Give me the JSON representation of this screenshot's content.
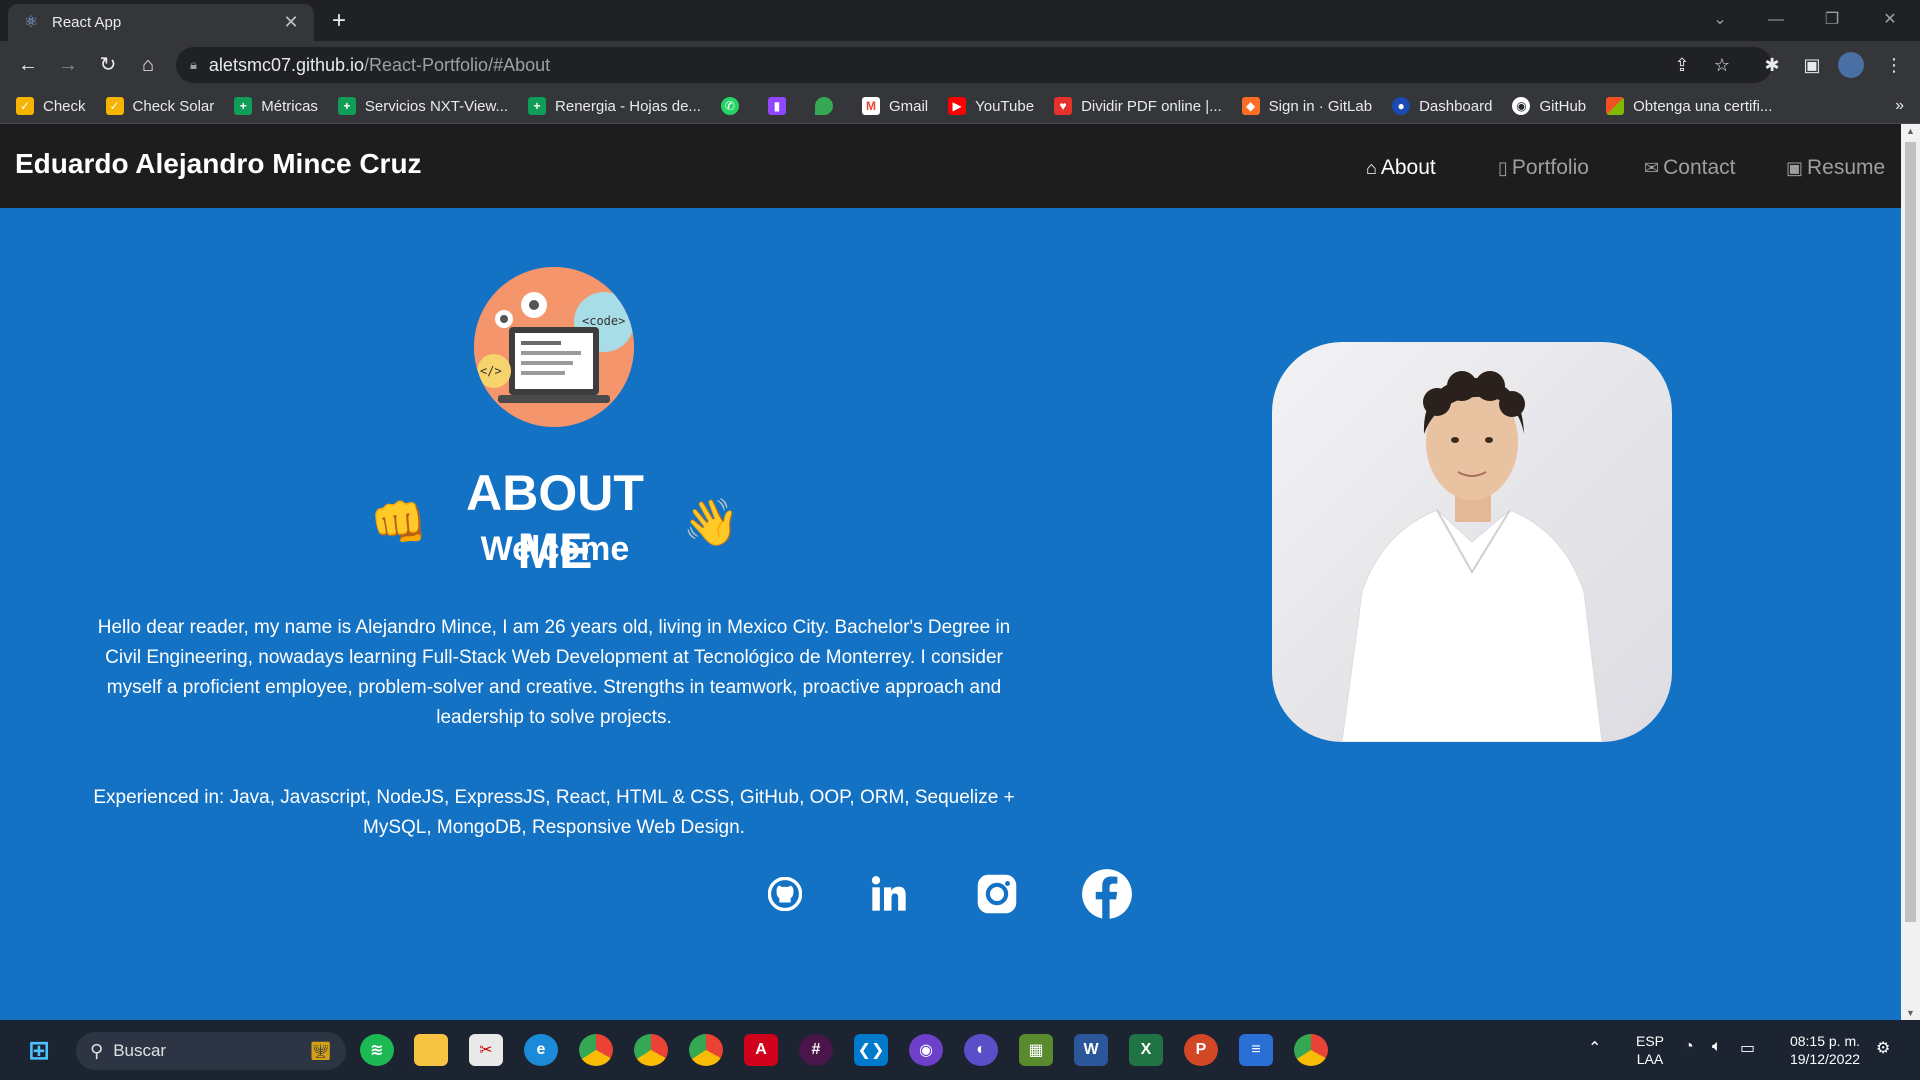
{
  "browser": {
    "tab_title": "React App",
    "url_host": "aletsmc07.github.io",
    "url_path": "/React-Portfolio/#About",
    "bookmarks": [
      {
        "label": "Check",
        "color": "#f4b400"
      },
      {
        "label": "Check Solar",
        "color": "#f4b400"
      },
      {
        "label": "Métricas",
        "color": "#0f9d58"
      },
      {
        "label": "Servicios NXT-View...",
        "color": "#0f9d58"
      },
      {
        "label": "Renergia - Hojas de...",
        "color": "#0f9d58"
      },
      {
        "label": "",
        "color": "#25d366"
      },
      {
        "label": "",
        "color": "#9146ff"
      },
      {
        "label": "",
        "color": "#34a853"
      },
      {
        "label": "Gmail",
        "color": "#ea4335"
      },
      {
        "label": "YouTube",
        "color": "#ff0000"
      },
      {
        "label": "Dividir PDF online |...",
        "color": "#e5322d"
      },
      {
        "label": "Sign in · GitLab",
        "color": "#fc6d26"
      },
      {
        "label": "Dashboard",
        "color": "#1a4ab3"
      },
      {
        "label": "GitHub",
        "color": "#ffffff"
      },
      {
        "label": "Obtenga una certifi...",
        "color": "#f25022"
      }
    ]
  },
  "site": {
    "brand": "Eduardo Alejandro Mince Cruz",
    "nav": [
      {
        "label": "About",
        "icon": "house-icon",
        "active": true
      },
      {
        "label": "Portfolio",
        "icon": "file-icon",
        "active": false
      },
      {
        "label": "Contact",
        "icon": "envelope-icon",
        "active": false
      },
      {
        "label": "Resume",
        "icon": "id-badge-icon",
        "active": false
      }
    ],
    "illustration_text": "<code>",
    "illustration_tag": "</>",
    "about_title": "ABOUT ME",
    "welcome": "Welcome",
    "bio": "Hello dear reader, my name is Alejandro Mince, I am 26 years old, living in Mexico City. Bachelor's Degree in Civil Engineering, nowadays learning Full-Stack Web Development at Tecnológico de Monterrey. I consider myself a proficient employee, problem-solver and creative. Strengths in teamwork, proactive approach and leadership to solve projects.",
    "skills": "Experienced in: Java, Javascript, NodeJS, ExpressJS, React, HTML & CSS, GitHub, OOP, ORM, Sequelize + MySQL, MongoDB, Responsive Web Design.",
    "socials": [
      "github-icon",
      "linkedin-icon",
      "instagram-icon",
      "facebook-icon"
    ],
    "colors": {
      "hero_bg": "#1472c4",
      "navbar_bg": "#1d1d1d",
      "illustration_bg": "#f4956c"
    }
  },
  "taskbar": {
    "search_placeholder": "Buscar",
    "lang_line1": "ESP",
    "lang_line2": "LAA",
    "time": "08:15 p. m.",
    "date": "19/12/2022"
  }
}
